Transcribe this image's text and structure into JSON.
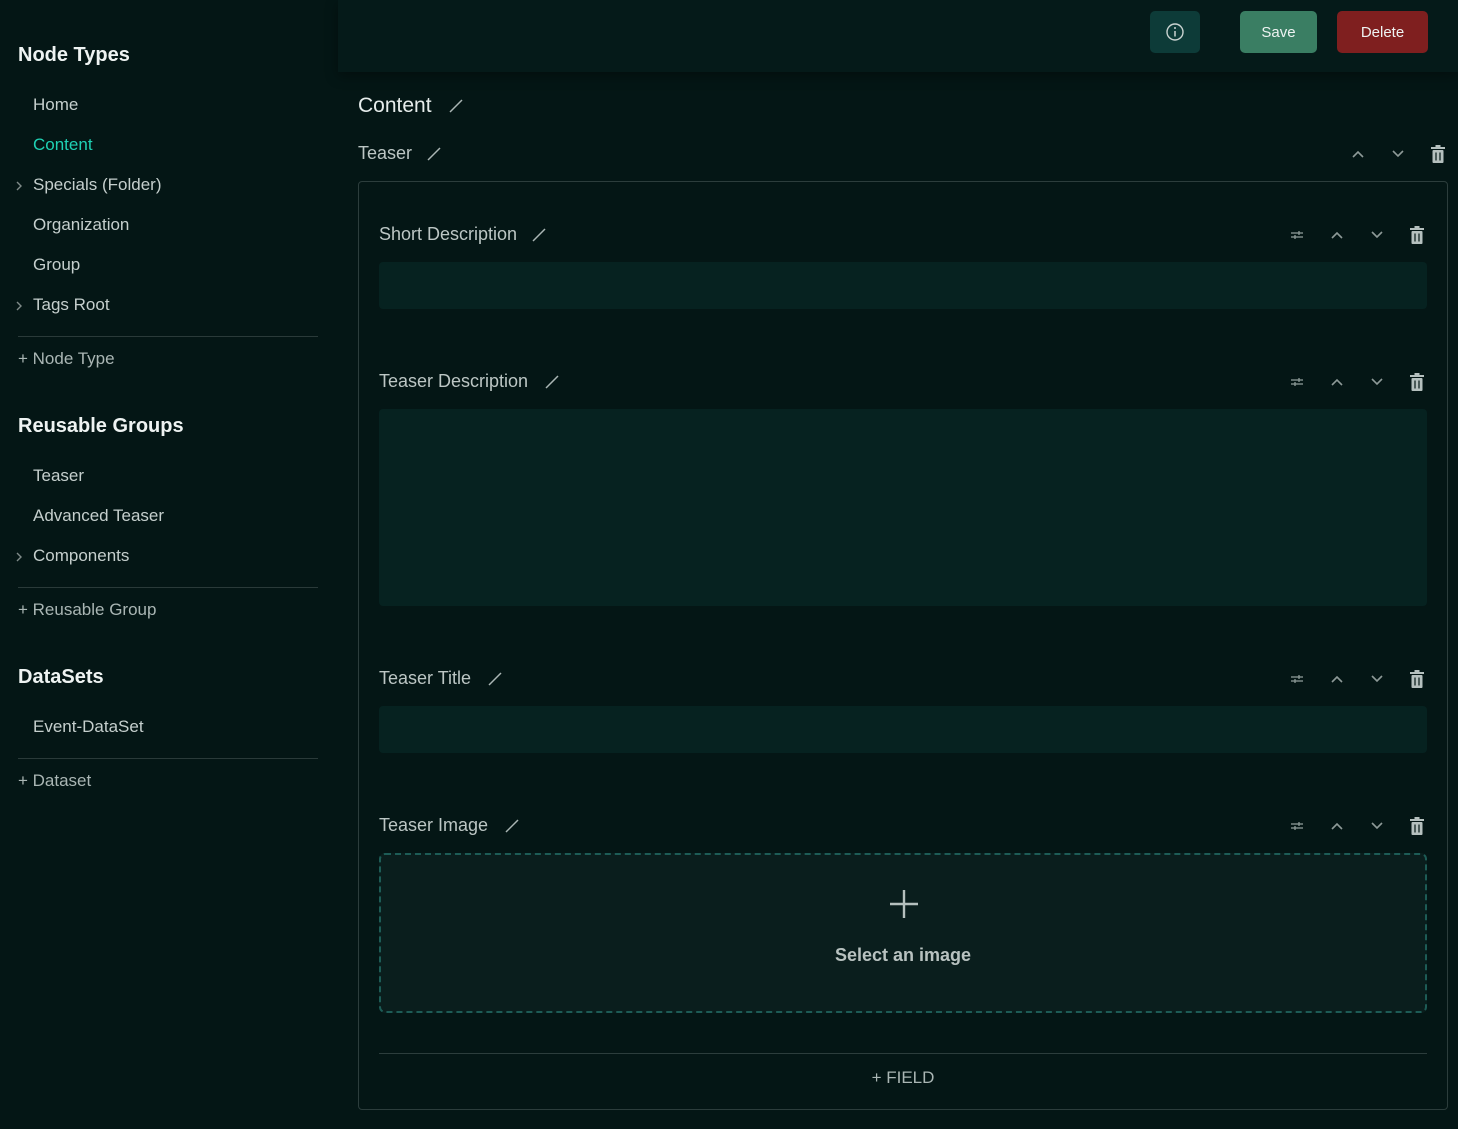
{
  "sidebar": {
    "node_types": {
      "title": "Node Types",
      "items": [
        {
          "label": "Home",
          "expandable": false,
          "active": false
        },
        {
          "label": "Content",
          "expandable": false,
          "active": true
        },
        {
          "label": "Specials (Folder)",
          "expandable": true,
          "active": false
        },
        {
          "label": "Organization",
          "expandable": false,
          "active": false
        },
        {
          "label": "Group",
          "expandable": false,
          "active": false
        },
        {
          "label": "Tags Root",
          "expandable": true,
          "active": false
        }
      ],
      "add_label": "+ Node Type"
    },
    "reusable_groups": {
      "title": "Reusable Groups",
      "items": [
        {
          "label": "Teaser",
          "expandable": false
        },
        {
          "label": "Advanced Teaser",
          "expandable": false
        },
        {
          "label": "Components",
          "expandable": true
        }
      ],
      "add_label": "+ Reusable Group"
    },
    "datasets": {
      "title": "DataSets",
      "items": [
        {
          "label": "Event-DataSet",
          "expandable": false
        }
      ],
      "add_label": "+ Dataset"
    }
  },
  "toolbar": {
    "info_icon": "info-icon",
    "save_label": "Save",
    "delete_label": "Delete"
  },
  "main": {
    "title": "Content",
    "group": {
      "title": "Teaser",
      "fields": [
        {
          "label": "Short Description",
          "type": "text",
          "value": ""
        },
        {
          "label": "Teaser Description",
          "type": "textarea",
          "value": ""
        },
        {
          "label": "Teaser Title",
          "type": "text",
          "value": ""
        },
        {
          "label": "Teaser Image",
          "type": "image",
          "placeholder": "Select an image"
        }
      ],
      "add_field_label": "+ FIELD"
    }
  },
  "colors": {
    "background": "#041615",
    "accent": "#1fd1b4",
    "save": "#3a7e63",
    "delete": "#7f1f1f",
    "input_bg": "#062220"
  }
}
